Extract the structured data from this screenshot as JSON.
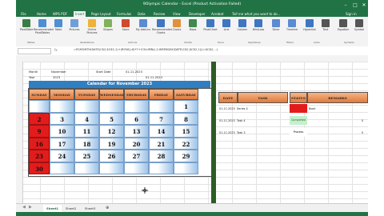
{
  "window": {
    "title": "9Olympic Calendar - Excel (Product Activation Failed)",
    "controls": [
      "–",
      "□",
      "✕"
    ]
  },
  "menu": {
    "tabs": [
      "File",
      "Home",
      "WPS PDF",
      "Insert",
      "Page Layout",
      "Formulas",
      "Data",
      "Review",
      "View",
      "Developer",
      "Acrobat"
    ],
    "active": "Insert",
    "tell_me": "Tell me what you want to do...",
    "sign_in": "Sign in"
  },
  "ribbon": {
    "items": [
      {
        "label": "PivotTable",
        "color": "#3a7d44"
      },
      {
        "label": "Recommended PivotTables",
        "color": "#4d8fd1"
      },
      {
        "label": "Table",
        "color": "#4d8fd1"
      },
      {
        "label": "Pictures",
        "color": "#6f9fd8"
      },
      {
        "label": "Online Pictures",
        "color": "#f0b23a"
      },
      {
        "label": "Shapes",
        "color": "#7fb25a"
      },
      {
        "label": "Store",
        "color": "#d04a2d"
      },
      {
        "label": "My Add-ins",
        "color": "#5b8bd0"
      },
      {
        "label": "Recommended Charts",
        "color": "#3f76bf"
      },
      {
        "label": "Charts",
        "color": "#e0913a"
      },
      {
        "label": "Maps",
        "color": "#3f8a4c"
      },
      {
        "label": "PivotChart",
        "color": "#3f76bf"
      },
      {
        "label": "Line",
        "color": "#3f76bf"
      },
      {
        "label": "Column",
        "color": "#3f76bf"
      },
      {
        "label": "Win/Loss",
        "color": "#3f76bf"
      },
      {
        "label": "Slicer",
        "color": "#5b8bd0"
      },
      {
        "label": "Timeline",
        "color": "#5b8bd0"
      },
      {
        "label": "Hyperlink",
        "color": "#3f76bf"
      },
      {
        "label": "Text",
        "color": "#555555"
      },
      {
        "label": "Equation",
        "color": "#555555"
      },
      {
        "label": "Symbol",
        "color": "#555555"
      }
    ],
    "groups": [
      "Tables",
      "Illustrations",
      "Add-ins",
      "Charts",
      "Tours",
      "Sparklines",
      "Filters",
      "Links",
      "Symbols"
    ]
  },
  "formula_bar": {
    "fx": "fx",
    "formula": "=IF(MONTH(DATE(C$2,$C$2,1)+(ROW()-6)*7+COLUMN()-2-WEEKDAY(DATE(C$2,$C$2,1)))=$C$2,...)"
  },
  "cells": {
    "month_label": "Month",
    "month_value": "November",
    "year_label": "Year",
    "year_value": "2023",
    "start_date_label": "Start Date",
    "start_date_value": "01-11-2023",
    "end_value": "01-11-2023"
  },
  "calendar": {
    "title": "Calendar for November 2023",
    "days": [
      "SUNDAY",
      "MONDAY",
      "TUESDAY",
      "WEDNESDAY",
      "THURSDAY",
      "FRIDAY",
      "SATURDAY"
    ],
    "weeks": [
      [
        "",
        "",
        "",
        "",
        "",
        "",
        "1"
      ],
      [
        "2",
        "3",
        "4",
        "5",
        "6",
        "7",
        "8"
      ],
      [
        "9",
        "10",
        "11",
        "12",
        "13",
        "14",
        "15"
      ],
      [
        "16",
        "17",
        "18",
        "19",
        "20",
        "21",
        "22"
      ],
      [
        "23",
        "24",
        "25",
        "26",
        "27",
        "28",
        "29"
      ],
      [
        "30",
        "",
        "",
        "",
        "",
        "",
        ""
      ]
    ]
  },
  "task_table": {
    "headers": [
      "DATE",
      "TASK",
      "STATUS",
      "REMARKS"
    ],
    "rows": [
      {
        "date": "01-11-2023",
        "task": "Series 4",
        "status": "",
        "status_color": "#e21c1c",
        "remark": "Book",
        "value": ""
      },
      {
        "date": "01-11-2023",
        "task": "Task 4",
        "status": "Completed",
        "status_color": "#c6efce",
        "remark": "",
        "value": "0"
      },
      {
        "date": "01-11-2023",
        "task": "Task 3",
        "status": "Process",
        "status_color": "#ffffff",
        "remark": "",
        "value": "0"
      }
    ]
  },
  "sheets": {
    "tabs": [
      "Sheet1",
      "Sheet2",
      "Sheet3"
    ],
    "active": "Sheet1",
    "add": "⊕"
  },
  "colors": {
    "excel_green": "#217346",
    "calendar_title_bg": "#2f7fc1",
    "holiday_red": "#e21c1c"
  }
}
